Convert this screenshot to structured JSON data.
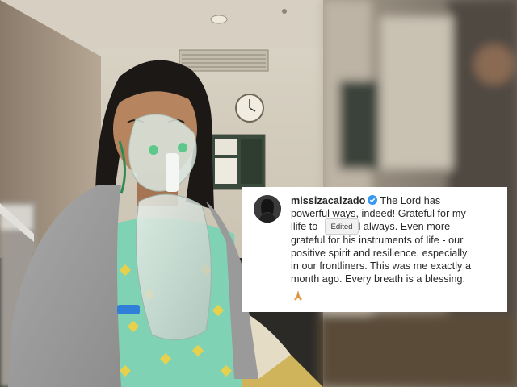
{
  "post": {
    "username": "missizacalzado",
    "verified_icon": "verified-badge-icon",
    "caption_line_1_rest": "The Lord has",
    "caption_lines": [
      "powerful ways, indeed! Grateful for my",
      "llife to",
      "d always. Even more",
      "grateful for his instruments of life - our",
      "positive spirit and resilience, especially",
      "in our frontliners. This was me exactly a",
      "month ago. Every breath is a blessing."
    ],
    "emoji_icon": "folded-hands-icon",
    "edited_label": "Edited"
  },
  "colors": {
    "verified_blue": "#3897f0",
    "caption_text": "#262626"
  }
}
